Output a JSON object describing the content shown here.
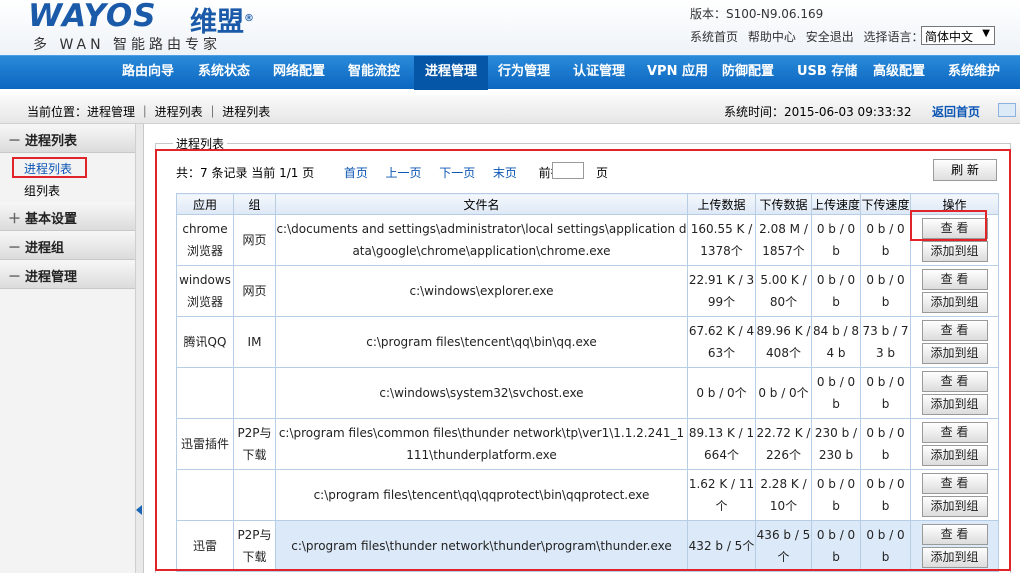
{
  "brand": {
    "logo_text": "WAYOS",
    "logo_cn": "维盟",
    "reg": "®",
    "slogan": "多 WAN 智能路由专家"
  },
  "header": {
    "version": "版本：S100-N9.06.169",
    "links": [
      "系统首页",
      "帮助中心",
      "安全退出",
      "选择语言："
    ],
    "language": "简体中文"
  },
  "nav": [
    "路由向导",
    "系统状态",
    "网络配置",
    "智能流控",
    "进程管理",
    "行为管理",
    "认证管理",
    "VPN 应用",
    "防御配置",
    "USB 存储",
    "高级配置",
    "系统维护"
  ],
  "breadcrumb": {
    "text": "当前位置：进程管理 ｜ 进程列表 ｜ 进程列表",
    "systime": "系统时间：2015-06-03 09:33:32",
    "back": "返回首页"
  },
  "sidebar": {
    "groups": [
      {
        "sign": "－",
        "label": "进程列表"
      },
      {
        "sign": "＋",
        "label": "基本设置"
      },
      {
        "sign": "－",
        "label": "进程组"
      },
      {
        "sign": "－",
        "label": "进程管理"
      }
    ],
    "subs": [
      "进程列表",
      "组列表"
    ]
  },
  "panel": {
    "legend": "进程列表",
    "refresh": "刷 新",
    "page_suffix": "页"
  },
  "pager": {
    "summary": "共：7 条记录 当前 1/1 页",
    "first": "首页",
    "prev": "上一页",
    "next": "下一页",
    "last": "末页",
    "goto": "前往 第"
  },
  "table": {
    "headers": [
      "应用",
      "组",
      "文件名",
      "上传数据",
      "下传数据",
      "上传速度",
      "下传速度",
      "操作"
    ],
    "view_label": "查 看",
    "add_label": "添加到组",
    "rows": [
      [
        "chrome浏览器",
        "网页",
        "c:\\documents and settings\\administrator\\local settings\\application data\\google\\chrome\\application\\chrome.exe",
        "160.55 K / 1378个",
        "2.08 M / 1857个",
        "0 b / 0 b",
        "0 b / 0 b"
      ],
      [
        "windows浏览器",
        "网页",
        "c:\\windows\\explorer.exe",
        "22.91 K / 399个",
        "5.00 K / 80个",
        "0 b / 0 b",
        "0 b / 0 b"
      ],
      [
        "腾讯QQ",
        "IM",
        "c:\\program files\\tencent\\qq\\bin\\qq.exe",
        "67.62 K / 463个",
        "89.96 K / 408个",
        "84 b / 84 b",
        "73 b / 73 b"
      ],
      [
        "",
        "",
        "c:\\windows\\system32\\svchost.exe",
        "0 b / 0个",
        "0 b / 0个",
        "0 b / 0 b",
        "0 b / 0 b"
      ],
      [
        "迅雷插件",
        "P2P与下载",
        "c:\\program files\\common files\\thunder network\\tp\\ver1\\1.1.2.241_1111\\thunderplatform.exe",
        "89.13 K / 1664个",
        "22.72 K / 226个",
        "230 b / 230 b",
        "0 b / 0 b"
      ],
      [
        "",
        "",
        "c:\\program files\\tencent\\qq\\qqprotect\\bin\\qqprotect.exe",
        "1.62 K / 11个",
        "2.28 K / 10个",
        "0 b / 0 b",
        "0 b / 0 b"
      ],
      [
        "迅雷",
        "P2P与下载",
        "c:\\program files\\thunder network\\thunder\\program\\thunder.exe",
        "432 b / 5个",
        "436 b / 5个",
        "0 b / 0 b",
        "0 b / 0 b"
      ]
    ]
  },
  "colors": {
    "nav_bg": "#0b66c0",
    "accent": "#1b5aa8",
    "highlight_border": "#e0242a",
    "row_highlight": "#dce9f8"
  }
}
